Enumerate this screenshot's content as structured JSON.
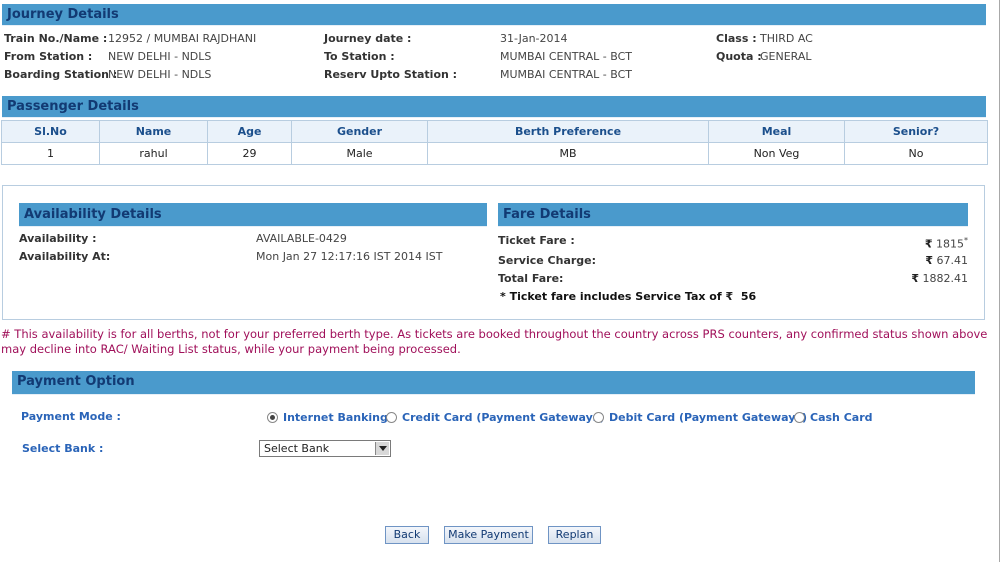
{
  "journey": {
    "title": "Journey Details",
    "train_label": "Train No./Name :",
    "train_value": "12952 / MUMBAI RAJDHANI",
    "from_label": "From Station :",
    "from_value": "NEW DELHI - NDLS",
    "boarding_label": "Boarding Station :",
    "boarding_value": "NEW DELHI - NDLS",
    "date_label": "Journey date :",
    "date_value": "31-Jan-2014",
    "to_label": "To Station :",
    "to_value": "MUMBAI CENTRAL - BCT",
    "reserv_label": "Reserv Upto Station :",
    "reserv_value": "MUMBAI CENTRAL - BCT",
    "class_label": "Class :",
    "class_value": "THIRD AC",
    "quota_label": "Quota :",
    "quota_value": "GENERAL"
  },
  "passengers": {
    "title": "Passenger Details",
    "headers": [
      "Sl.No",
      "Name",
      "Age",
      "Gender",
      "Berth Preference",
      "Meal",
      "Senior?"
    ],
    "rows": [
      [
        "1",
        "rahul",
        "29",
        "Male",
        "MB",
        "Non Veg",
        "No"
      ]
    ]
  },
  "availability": {
    "title": "Availability Details",
    "avail_label": "Availability :",
    "avail_value": "AVAILABLE-0429",
    "avail_at_label": "Availability At:",
    "avail_at_value": "Mon Jan 27 12:17:16 IST 2014 IST"
  },
  "fare": {
    "title": "Fare Details",
    "ticket_label": "Ticket Fare :",
    "ticket_value": "1815",
    "ticket_mark": "*",
    "service_label": "Service Charge:",
    "service_value": "67.41",
    "total_label": "Total Fare:",
    "total_value": "1882.41",
    "tax_note": "* Ticket fare includes Service Tax of",
    "tax_value": "56",
    "rupee": "₹"
  },
  "notice": "# This availability is for all berths, not for your preferred berth type. As tickets are booked throughout the country across PRS counters, any confirmed status shown above may decline into RAC/ Waiting List status, while your payment being processed.",
  "payment": {
    "title": "Payment Option",
    "mode_label": "Payment Mode :",
    "options": [
      "Internet Banking",
      "Credit Card (Payment Gateways)",
      "Debit Card (Payment Gateways)",
      "Cash Card"
    ],
    "selected_option": "Internet Banking",
    "bank_label": "Select Bank :",
    "bank_value": "Select Bank"
  },
  "buttons": {
    "back": "Back",
    "make_payment": "Make Payment",
    "replan": "Replan"
  },
  "colors": {
    "header_bar": "#4a9acc",
    "header_text": "#123a73",
    "notice_text": "#a0105a",
    "link_blue": "#2a64b8"
  }
}
